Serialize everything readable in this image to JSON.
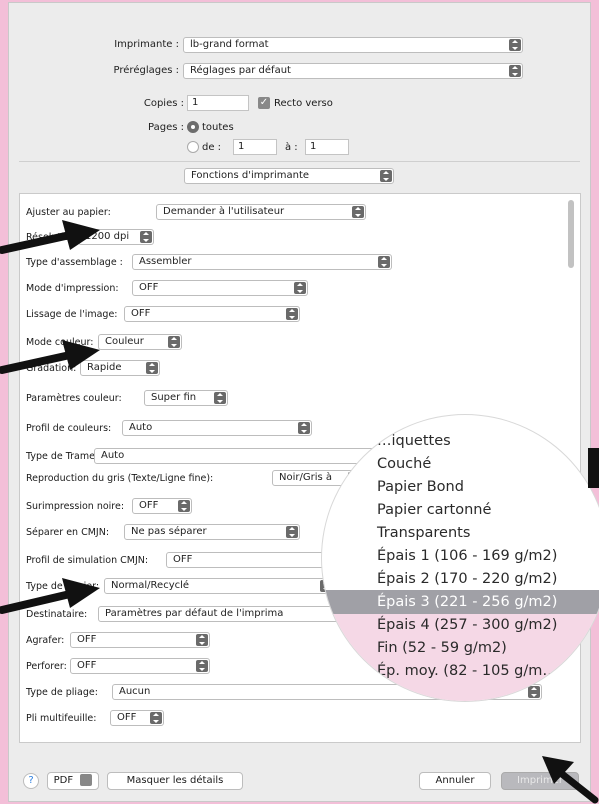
{
  "header": {
    "printer_label": "Imprimante :",
    "printer_value": "lb-grand format",
    "presets_label": "Préréglages :",
    "presets_value": "Réglages par défaut",
    "copies_label": "Copies :",
    "copies_value": "1",
    "duplex_label": "Recto verso",
    "pages_label": "Pages :",
    "pages_all": "toutes",
    "pages_from": "de :",
    "pages_from_value": "1",
    "pages_to": "à :",
    "pages_to_value": "1",
    "section_popup": "Fonctions d'imprimante"
  },
  "settings": [
    {
      "label": "Ajuster au papier:",
      "value": "Demander à l'utilisateur"
    },
    {
      "label": "Résolution:",
      "value": "1200 dpi"
    },
    {
      "label": "Type d'assemblage :",
      "value": "Assembler"
    },
    {
      "label": "Mode d'impression:",
      "value": "OFF"
    },
    {
      "label": "Lissage de l'image:",
      "value": "OFF"
    },
    {
      "label": "Mode couleur:",
      "value": "Couleur"
    },
    {
      "label": "Gradation:",
      "value": "Rapide"
    },
    {
      "label": "Paramètres couleur:",
      "value": "Super fin"
    },
    {
      "label": "Profil de couleurs:",
      "value": "Auto"
    },
    {
      "label": "Type de Trame:",
      "value": "Auto"
    },
    {
      "label": "Reproduction du gris (Texte/Ligne fine):",
      "value": "Noir/Gris à"
    },
    {
      "label": "Surimpression noire:",
      "value": "OFF"
    },
    {
      "label": "Séparer en CMJN:",
      "value": "Ne pas séparer"
    },
    {
      "label": "Profil de simulation CMJN:",
      "value": "OFF"
    },
    {
      "label": "Type de papier:",
      "value": "Normal/Recyclé"
    },
    {
      "label": "Destinataire:",
      "value": "Paramètres par défaut de l'imprima"
    },
    {
      "label": "Agrafer:",
      "value": "OFF"
    },
    {
      "label": "Perforer:",
      "value": "OFF"
    },
    {
      "label": "Type de pliage:",
      "value": "Aucun"
    },
    {
      "label": "Pli multifeuille:",
      "value": "OFF"
    }
  ],
  "paper_menu": {
    "items": [
      "…iquettes",
      "Couché",
      "Papier Bond",
      "Papier cartonné",
      "Transparents",
      "Épais 1 (106 - 169 g/m2)",
      "Épais 2 (170 - 220 g/m2)",
      "Épais 3 (221 - 256 g/m2)",
      "Épais 4 (257 - 300 g/m2)",
      "Fin (52 - 59 g/m2)",
      "Ép. moy. (82 - 105 g/m…"
    ],
    "selected_index": 7
  },
  "footer": {
    "help": "?",
    "pdf": "PDF",
    "details": "Masquer les détails",
    "cancel": "Annuler",
    "print": "Imprimer"
  },
  "colors": {
    "background": "#f3bfd8",
    "selection": "#a0a0a6",
    "arrow": "#111111"
  },
  "icons": [
    "help-icon",
    "pdf-dropdown-icon",
    "popup-stepper-icon",
    "checkmark-icon",
    "arrow-pointer-icon"
  ]
}
